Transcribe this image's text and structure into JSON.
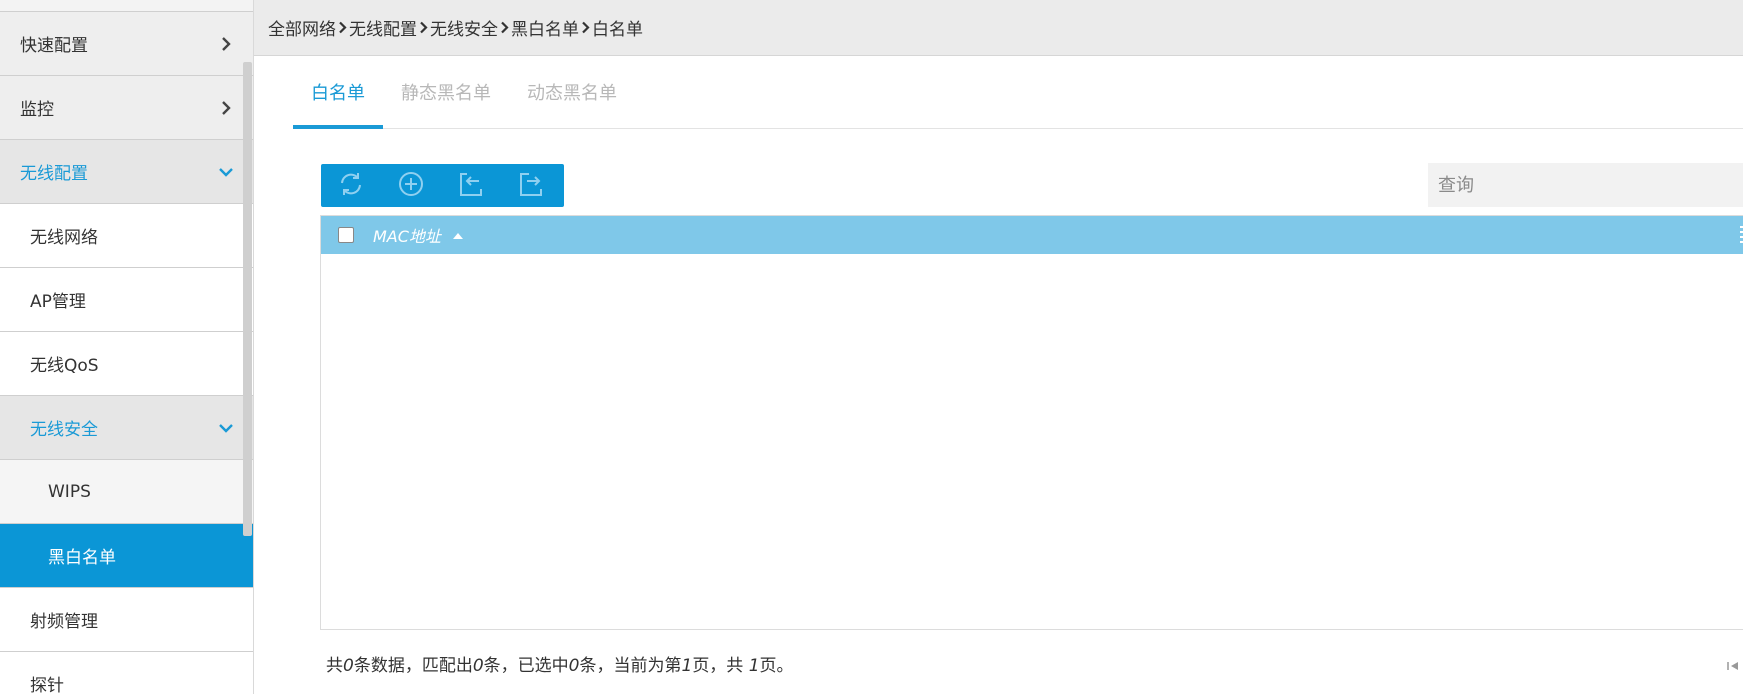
{
  "sidebar": {
    "items": [
      {
        "label": "快速配置"
      },
      {
        "label": "监控"
      },
      {
        "label": "无线配置"
      },
      {
        "label": "无线网络"
      },
      {
        "label": "AP管理"
      },
      {
        "label": "无线QoS"
      },
      {
        "label": "无线安全"
      },
      {
        "label": "WIPS"
      },
      {
        "label": "黑白名单"
      },
      {
        "label": "射频管理"
      },
      {
        "label": "探针"
      }
    ],
    "colors": {
      "accent": "#1a9ad6",
      "active_bg": "#0b96d6"
    }
  },
  "breadcrumb": [
    "全部网络",
    "无线配置",
    "无线安全",
    "黑白名单",
    "白名单"
  ],
  "tabs": [
    {
      "label": "白名单"
    },
    {
      "label": "静态黑名单"
    },
    {
      "label": "动态黑名单"
    }
  ],
  "toolbar": {
    "buttons": [
      {
        "icon": "refresh-icon"
      },
      {
        "icon": "add-circle-icon"
      },
      {
        "icon": "import-icon"
      },
      {
        "icon": "export-icon"
      }
    ]
  },
  "search": {
    "placeholder": "查询"
  },
  "table": {
    "columns": [
      {
        "label": "MAC地址",
        "sort": "ascending"
      }
    ],
    "rows": []
  },
  "footer": {
    "p1": "共",
    "total": "0",
    "p2": "条数据，匹配出",
    "matched": "0",
    "p3": "条，已选中",
    "selected": "0",
    "p4": "条，当前为第",
    "page": "1",
    "p5": "页，共 ",
    "pages": "1",
    "p6": "页。"
  }
}
